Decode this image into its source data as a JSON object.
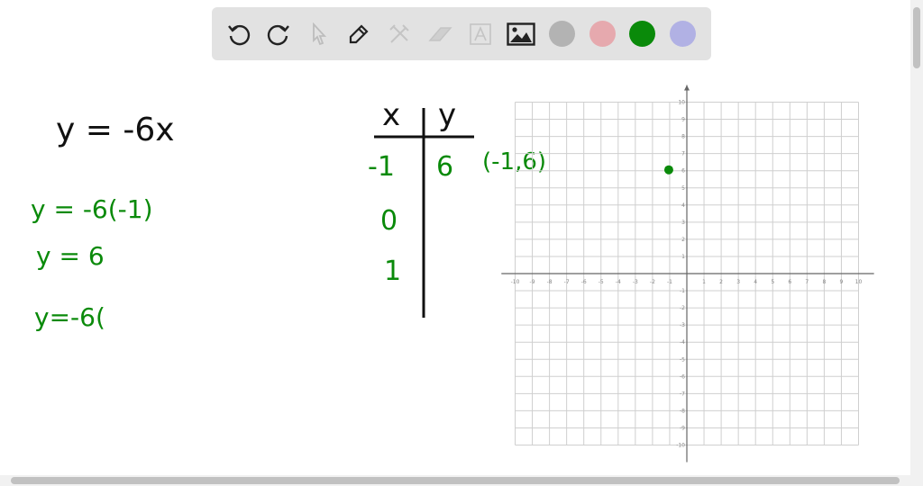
{
  "toolbar": {
    "tools": [
      "undo-icon",
      "redo-icon",
      "select-pointer-icon",
      "pen-icon",
      "tools-icon",
      "eraser-icon",
      "text-icon",
      "image-icon"
    ],
    "colors": [
      "#b3b3b3",
      "#e6a9ae",
      "#0a8a0a",
      "#b1b1e4"
    ]
  },
  "board": {
    "equation": "y = -6x",
    "work": [
      "y = -6(-1)",
      "y = 6",
      "y=-6("
    ],
    "table": {
      "headers": [
        "x",
        "y"
      ],
      "x_values": [
        "-1",
        "0",
        "1"
      ],
      "y_values": [
        "6"
      ]
    },
    "point_label": "(-1,6)"
  },
  "chart_data": {
    "type": "scatter",
    "title": "",
    "xlabel": "",
    "ylabel": "",
    "xlim": [
      -10,
      10
    ],
    "ylim": [
      -10,
      10
    ],
    "grid": true,
    "x_ticks": [
      -10,
      -9,
      -8,
      -7,
      -6,
      -5,
      -4,
      -3,
      -2,
      -1,
      1,
      2,
      3,
      4,
      5,
      6,
      7,
      8,
      9,
      10
    ],
    "y_ticks": [
      -10,
      -9,
      -8,
      -7,
      -6,
      -5,
      -4,
      -3,
      -2,
      -1,
      1,
      2,
      3,
      4,
      5,
      6,
      7,
      8,
      9,
      10
    ],
    "points": [
      {
        "x": -1,
        "y": 6
      }
    ],
    "point_color": "#0a8a0a"
  }
}
